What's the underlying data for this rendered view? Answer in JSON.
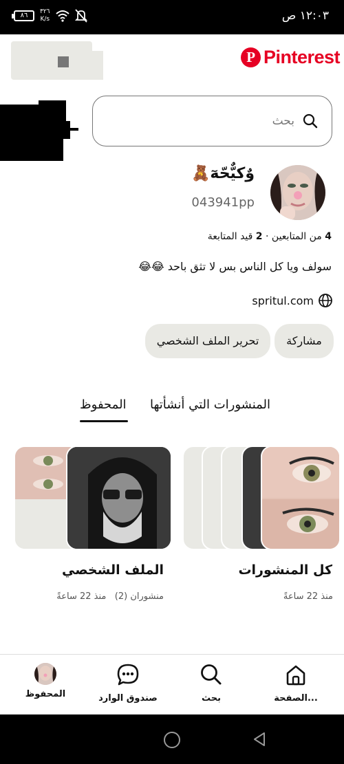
{
  "status_bar": {
    "time": "١٢:٠٣ ص",
    "battery": "٨٦",
    "speed_value": "٣٢٦",
    "speed_unit": "K/s"
  },
  "header": {
    "logo_text": "Pinterest",
    "logo_color": "#e60023"
  },
  "search": {
    "placeholder": "بحث",
    "icon": "search-icon"
  },
  "profile": {
    "display_name": "وٌكيٌّحّهٓ🧸",
    "username": "043941pp",
    "followers_count": "4",
    "followers_label": "من المتابعين",
    "separator": "·",
    "following_count": "2",
    "following_label": "قيد المتابعة",
    "bio": "سولف ويا كل الناس بس لا تثق باحد 😂😂",
    "website": "spritul.com",
    "website_icon": "globe-icon"
  },
  "actions": {
    "share_label": "مشاركة",
    "edit_label": "تحرير الملف الشخصي"
  },
  "tabs": [
    {
      "label": "المنشورات التي أنشأتها",
      "active": false
    },
    {
      "label": "المحفوظ",
      "active": true
    }
  ],
  "boards": [
    {
      "title": "كل المنشورات",
      "meta": "منذ 22 ساعةً"
    },
    {
      "title": "الملف الشخصي",
      "pins": "منشوران (2)",
      "meta": "منذ 22 ساعةً"
    }
  ],
  "bottom_nav": [
    {
      "label": "الصفحة...",
      "icon": "home-icon"
    },
    {
      "label": "بحث",
      "icon": "search-icon"
    },
    {
      "label": "صندوق الوارد",
      "icon": "chat-bubble-icon"
    },
    {
      "label": "المحفوظ",
      "icon": "avatar"
    }
  ]
}
